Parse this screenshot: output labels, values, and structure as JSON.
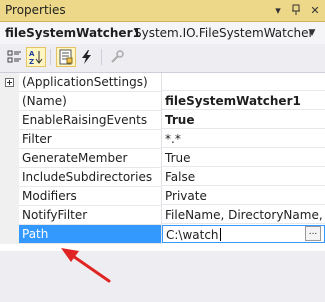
{
  "titlebar": {
    "title": "Properties",
    "dropdown_glyph": "▾",
    "pin_glyph": "⊓",
    "close_glyph": "✕"
  },
  "object_selector": {
    "name": "fileSystemWatcher1",
    "type": "System.IO.FileSystemWatcher"
  },
  "toolbar": {
    "buttons": [
      {
        "icon": "categorized-icon",
        "active": false
      },
      {
        "icon": "alphabetical-icon",
        "active": true
      },
      {
        "icon": "properties-icon",
        "active": true
      },
      {
        "icon": "events-icon",
        "active": false
      },
      {
        "icon": "property-pages-icon",
        "active": false
      }
    ]
  },
  "grid": {
    "rows": [
      {
        "name": "(ApplicationSettings)",
        "value": ""
      },
      {
        "name": "(Name)",
        "value": "fileSystemWatcher1"
      },
      {
        "name": "EnableRaisingEvents",
        "value": "True"
      },
      {
        "name": "Filter",
        "value": "*.*"
      },
      {
        "name": "GenerateMember",
        "value": "True"
      },
      {
        "name": "IncludeSubdirectories",
        "value": "False"
      },
      {
        "name": "Modifiers",
        "value": "Private"
      },
      {
        "name": "NotifyFilter",
        "value": "FileName, DirectoryName, LastWrite"
      },
      {
        "name": "Path",
        "value": "C:\\watch"
      }
    ],
    "ellipsis_label": "..."
  },
  "colors": {
    "titlebar": "#ecd888",
    "selection": "#3399ff",
    "annotation_arrow": "#e02424"
  }
}
